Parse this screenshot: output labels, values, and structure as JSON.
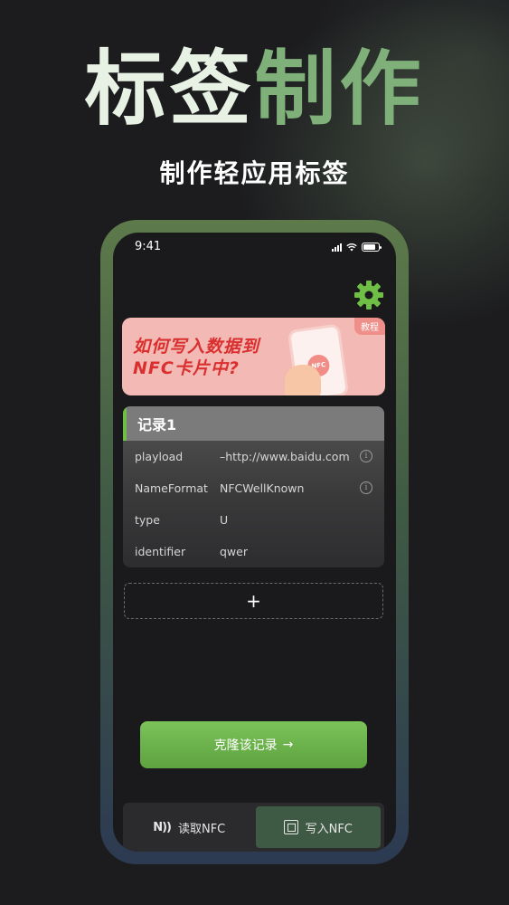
{
  "hero": {
    "title_part1": "标签",
    "title_part2": "制作",
    "subtitle": "制作轻应用标签"
  },
  "status_bar": {
    "time": "9:41"
  },
  "banner": {
    "line1": "如何写入数据到",
    "line2": "NFC卡片中?",
    "badge": "教程",
    "phone_label": "NFC"
  },
  "record": {
    "title": "记录1",
    "rows": [
      {
        "key": "playload",
        "value": "–http://www.baidu.com",
        "info": true
      },
      {
        "key": "NameFormat",
        "value": "NFCWellKnown",
        "info": true
      },
      {
        "key": "type",
        "value": "U",
        "info": false
      },
      {
        "key": "identifier",
        "value": "qwer",
        "info": false
      }
    ]
  },
  "add_button": {
    "label": "+"
  },
  "clone_button": {
    "label": "克隆该记录",
    "arrow": "→"
  },
  "tabs": {
    "read": {
      "icon_text": "N))",
      "label": "读取NFC"
    },
    "write": {
      "label": "写入NFC"
    }
  },
  "colors": {
    "accent_green": "#6fbf47",
    "title_green": "#7fb07a",
    "banner_pink": "#f3b9b4",
    "banner_red": "#d92f2f",
    "active_tab": "#3e5a44"
  },
  "icons": {
    "settings": "gear-icon",
    "info": "info-icon",
    "read_nfc": "nfc-signal-icon",
    "write_nfc": "nfc-write-icon"
  }
}
